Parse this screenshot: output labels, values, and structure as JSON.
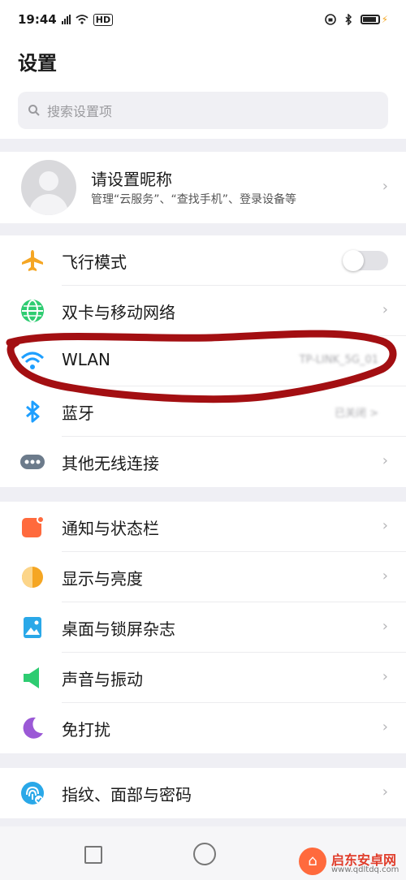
{
  "status": {
    "time": "19:44",
    "signal_text": "5G",
    "hd": "HD"
  },
  "header": {
    "title": "设置"
  },
  "search": {
    "placeholder": "搜索设置项"
  },
  "profile": {
    "name": "请设置昵称",
    "subtitle": "管理“云服务”、“查找手机”、登录设备等"
  },
  "rows": [
    {
      "label": "飞行模式",
      "control": "toggle-off",
      "icon": "airplane-icon",
      "color": "#f5a623"
    },
    {
      "label": "双卡与移动网络",
      "control": "chevron",
      "icon": "globe-icon",
      "color": "#2ecc71"
    },
    {
      "label": "WLAN",
      "value": "TP-LINK_5G_01",
      "icon": "wifi-icon",
      "color": "#1e9fff"
    },
    {
      "label": "蓝牙",
      "value": "已关闭 >",
      "icon": "bluetooth-icon",
      "color": "#1e9fff"
    },
    {
      "label": "其他无线连接",
      "control": "chevron",
      "icon": "more-dots-icon",
      "color": "#6c7b8b"
    },
    {
      "label": "通知与状态栏",
      "control": "chevron",
      "icon": "notification-icon",
      "color": "#ff6a3d"
    },
    {
      "label": "显示与亮度",
      "control": "chevron",
      "icon": "brightness-icon",
      "color": "#f5a623"
    },
    {
      "label": "桌面与锁屏杂志",
      "control": "chevron",
      "icon": "wallpaper-icon",
      "color": "#2aa8e8"
    },
    {
      "label": "声音与振动",
      "control": "chevron",
      "icon": "speaker-icon",
      "color": "#2ecc71"
    },
    {
      "label": "免打扰",
      "control": "chevron",
      "icon": "moon-icon",
      "color": "#9b59d6"
    },
    {
      "label": "指纹、面部与密码",
      "control": "chevron",
      "icon": "fingerprint-icon",
      "color": "#2aa8e8"
    }
  ],
  "chevron": "›",
  "annotation": {
    "color": "#a30f12"
  },
  "watermark": {
    "name": "启东安卓网",
    "url": "www.qdltdq.com"
  }
}
